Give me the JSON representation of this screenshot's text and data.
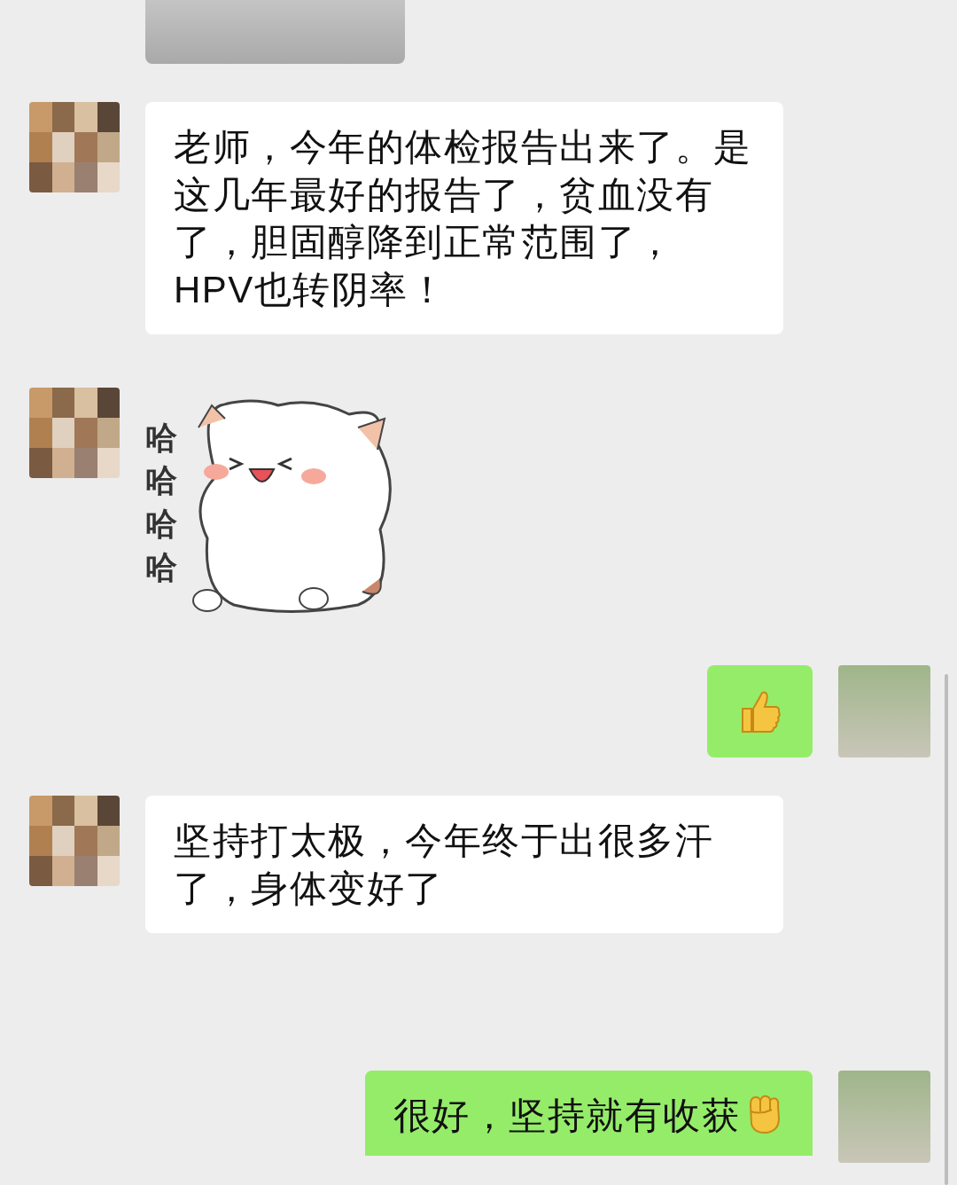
{
  "messages": [
    {
      "outgoing": false,
      "kind": "photo"
    },
    {
      "outgoing": false,
      "kind": "text",
      "text": "老师，今年的体检报告出来了。是这几年最好的报告了，贫血没有了，胆固醇降到正常范围了，HPV也转阴率！"
    },
    {
      "outgoing": false,
      "kind": "sticker",
      "text": "哈哈哈哈"
    },
    {
      "outgoing": true,
      "kind": "thumbs_up"
    },
    {
      "outgoing": false,
      "kind": "text",
      "text": "坚持打太极，今年终于出很多汗了，身体变好了"
    },
    {
      "outgoing": true,
      "kind": "text_fist",
      "text": "很好，坚持就有收获"
    }
  ]
}
